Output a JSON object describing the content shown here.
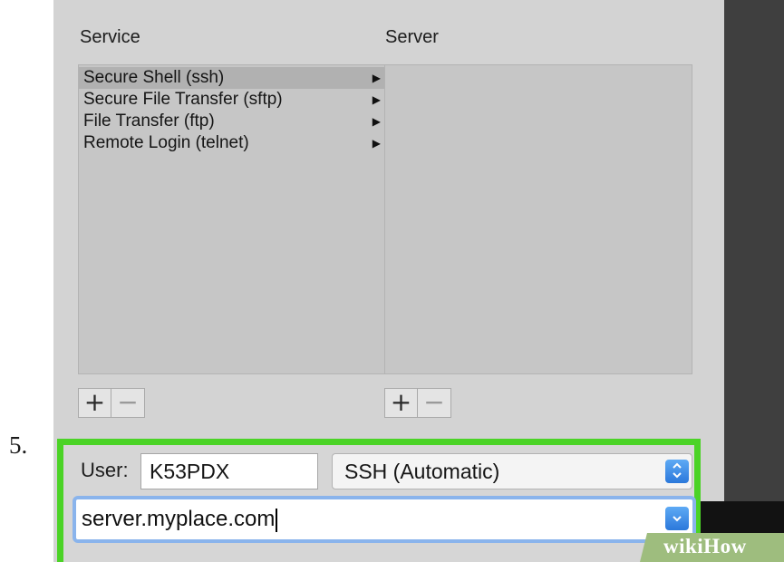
{
  "step": {
    "number": "5."
  },
  "columns": {
    "service": "Service",
    "server": "Server"
  },
  "services": [
    {
      "label": "Secure Shell (ssh)",
      "arrow": "▶",
      "selected": true
    },
    {
      "label": "Secure File Transfer (sftp)",
      "arrow": "▶",
      "selected": false
    },
    {
      "label": "File Transfer (ftp)",
      "arrow": "▶",
      "selected": false
    },
    {
      "label": "Remote Login (telnet)",
      "arrow": "▶",
      "selected": false
    }
  ],
  "buttons": {
    "add": "+",
    "remove": "−"
  },
  "user": {
    "label": "User:",
    "value": "K53PDX"
  },
  "protocol": {
    "value": "SSH (Automatic)",
    "stepper_icon": "updown-chevron-icon"
  },
  "server_address": {
    "value": "server.myplace.com",
    "dropdown_icon": "chevron-down-icon"
  },
  "watermark": {
    "text": "wikiHow"
  },
  "colors": {
    "highlight": "#4bd326",
    "accent": "#2b78db",
    "focus_ring": "#8ab4ec"
  }
}
